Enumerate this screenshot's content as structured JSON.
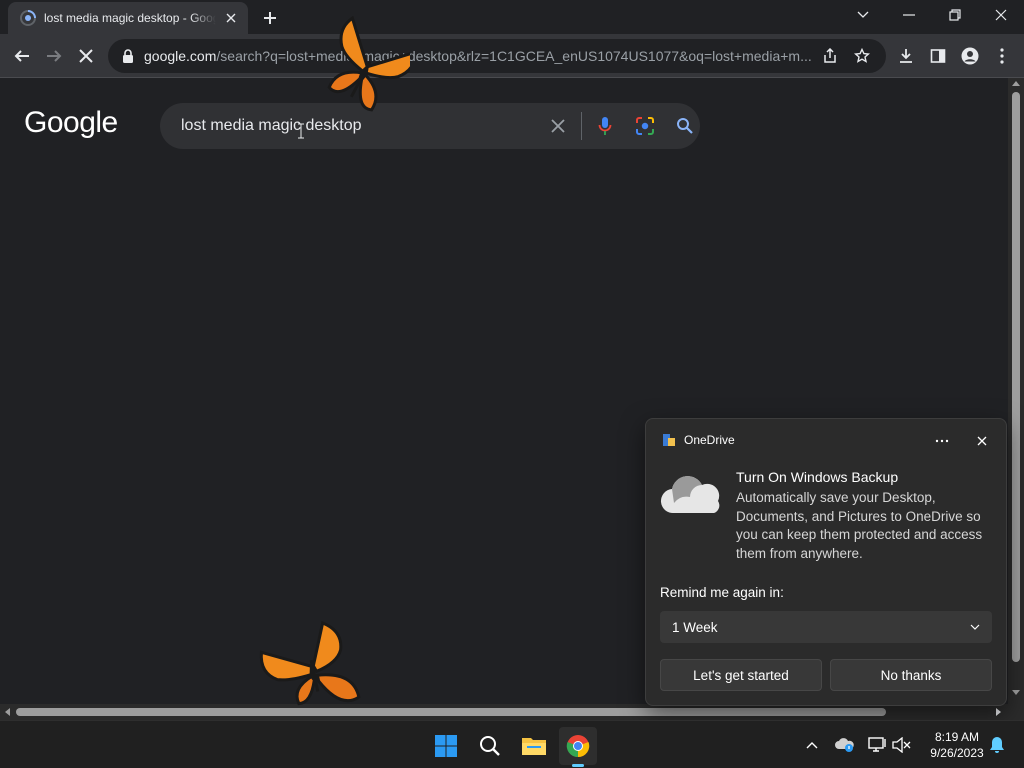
{
  "browser": {
    "tab": {
      "title": "lost media magic desktop - Google Search"
    },
    "address": {
      "host": "google.com",
      "path": "/search?q=lost+media+magic+desktop&rlz=1C1GCEA_enUS1074US1077&oq=lost+media+m..."
    }
  },
  "page": {
    "logo": "Google",
    "search_value": "lost media magic desktop"
  },
  "toast": {
    "app_name": "OneDrive",
    "title": "Turn On Windows Backup",
    "body": "Automatically save your Desktop, Documents, and Pictures to OneDrive so you can keep them protected and access them from anywhere.",
    "remind_label": "Remind me again in:",
    "remind_value": "1 Week",
    "primary_button": "Let's get started",
    "secondary_button": "No thanks"
  },
  "taskbar": {
    "time": "8:19 AM",
    "date": "9/26/2023"
  },
  "colors": {
    "accent_blue": "#8ab4f8",
    "chrome_red": "#ea4335",
    "chrome_green": "#34a853",
    "chrome_yellow": "#fbbc04",
    "windows_blue": "#1e90ff"
  }
}
